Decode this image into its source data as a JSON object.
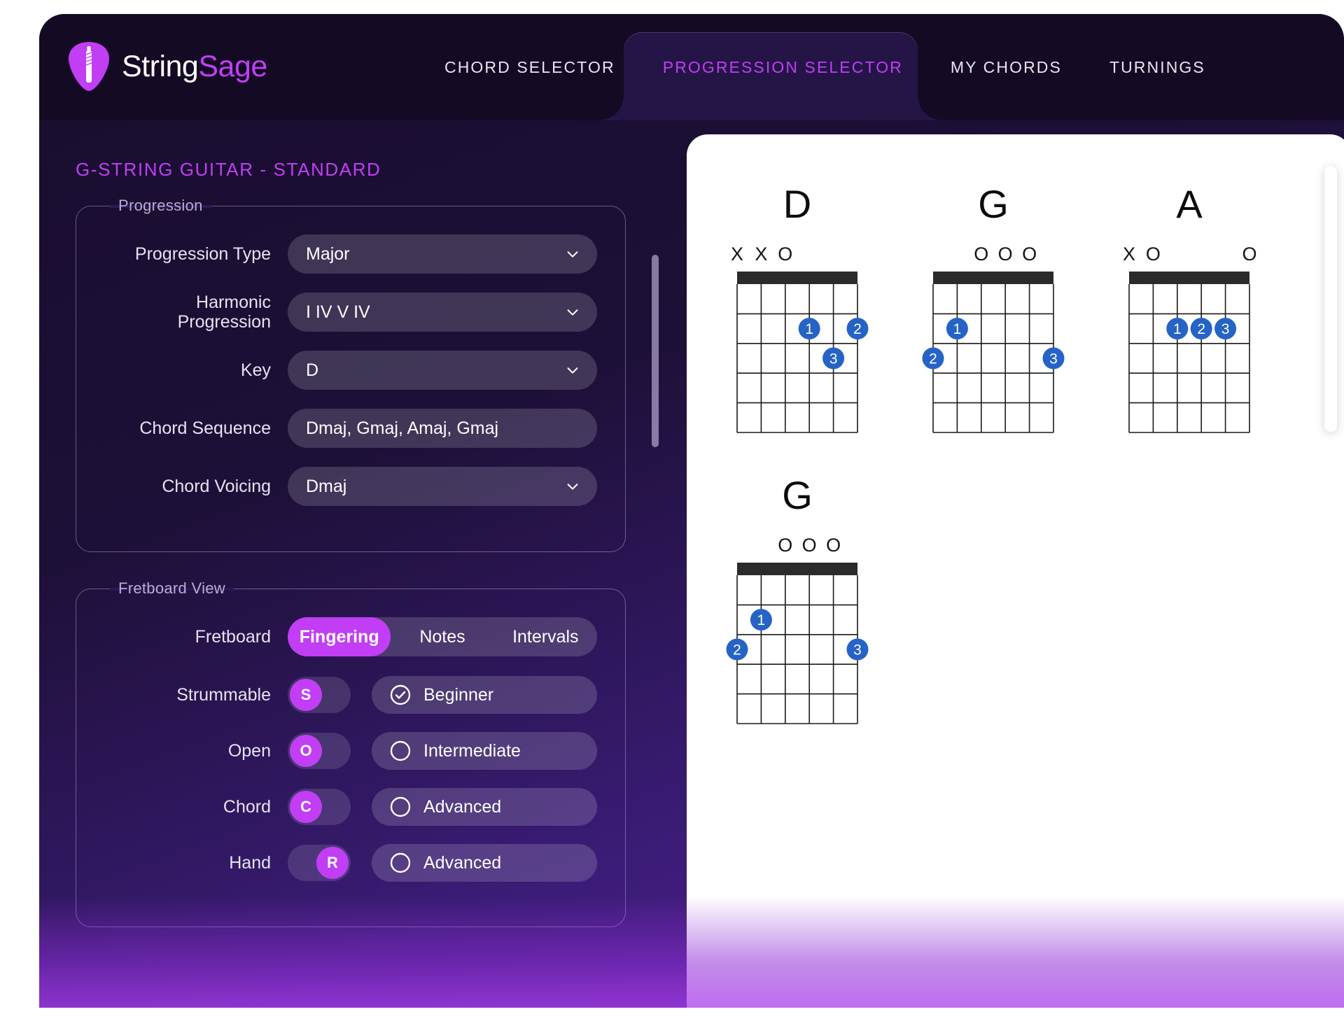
{
  "brand": {
    "name_first": "String",
    "name_second": "Sage",
    "logo_icon": "guitar-pick-icon"
  },
  "nav": {
    "tabs": [
      {
        "label": "CHORD SELECTOR",
        "active": false
      },
      {
        "label": "PROGRESSION SELECTOR",
        "active": true
      },
      {
        "label": "MY CHORDS",
        "active": false
      },
      {
        "label": "TURNINGS",
        "active": false
      }
    ]
  },
  "left_panel": {
    "title": "G-STRING GUITAR - STANDARD",
    "progression": {
      "legend": "Progression",
      "rows": [
        {
          "label": "Progression Type",
          "value": "Major",
          "has_chevron": true
        },
        {
          "label": "Harmonic Progression",
          "value": "I IV V IV",
          "has_chevron": true
        },
        {
          "label": "Key",
          "value": "D",
          "has_chevron": true
        },
        {
          "label": "Chord Sequence",
          "value": "Dmaj, Gmaj, Amaj, Gmaj",
          "has_chevron": false
        },
        {
          "label": "Chord Voicing",
          "value": "Dmaj",
          "has_chevron": true
        }
      ]
    },
    "fretboard_view": {
      "legend": "Fretboard View",
      "fretboard_label": "Fretboard",
      "segments": [
        {
          "label": "Fingering",
          "active": true
        },
        {
          "label": "Notes",
          "active": false
        },
        {
          "label": "Intervals",
          "active": false
        }
      ],
      "toggles": [
        {
          "label": "Strummable",
          "knob": "S",
          "knob_side": "left",
          "radio": "Beginner",
          "radio_checked": true
        },
        {
          "label": "Open",
          "knob": "O",
          "knob_side": "left",
          "radio": "Intermediate",
          "radio_checked": false
        },
        {
          "label": "Chord",
          "knob": "C",
          "knob_side": "left",
          "radio": "Advanced",
          "radio_checked": false
        },
        {
          "label": "Hand",
          "knob": "R",
          "knob_side": "right",
          "radio": "Advanced",
          "radio_checked": false
        }
      ]
    },
    "scrollbar_name": "left-panel-scrollbar"
  },
  "chords": [
    {
      "name": "D",
      "markers": [
        "X",
        "X",
        "O",
        "",
        "",
        ""
      ],
      "dots": [
        {
          "string": 4,
          "fret": 2,
          "finger": "1"
        },
        {
          "string": 6,
          "fret": 2,
          "finger": "2"
        },
        {
          "string": 5,
          "fret": 3,
          "finger": "3"
        }
      ]
    },
    {
      "name": "G",
      "markers": [
        "",
        "",
        "O",
        "O",
        "O",
        ""
      ],
      "dots": [
        {
          "string": 2,
          "fret": 2,
          "finger": "1"
        },
        {
          "string": 1,
          "fret": 3,
          "finger": "2"
        },
        {
          "string": 6,
          "fret": 3,
          "finger": "3"
        }
      ]
    },
    {
      "name": "A",
      "markers": [
        "X",
        "O",
        "",
        "",
        "",
        "O"
      ],
      "dots": [
        {
          "string": 3,
          "fret": 2,
          "finger": "1"
        },
        {
          "string": 4,
          "fret": 2,
          "finger": "2"
        },
        {
          "string": 5,
          "fret": 2,
          "finger": "3"
        }
      ]
    },
    {
      "name": "G",
      "markers": [
        "",
        "",
        "O",
        "O",
        "O",
        ""
      ],
      "dots": [
        {
          "string": 2,
          "fret": 2,
          "finger": "1"
        },
        {
          "string": 1,
          "fret": 3,
          "finger": "2"
        },
        {
          "string": 6,
          "fret": 3,
          "finger": "3"
        }
      ]
    }
  ],
  "colors": {
    "accent_magenta": "#c13ef5",
    "dot_blue": "#2563c7",
    "panel_white": "#ffffff",
    "bg_dark": "#190d2e",
    "nut_black": "#2b2b2b"
  }
}
